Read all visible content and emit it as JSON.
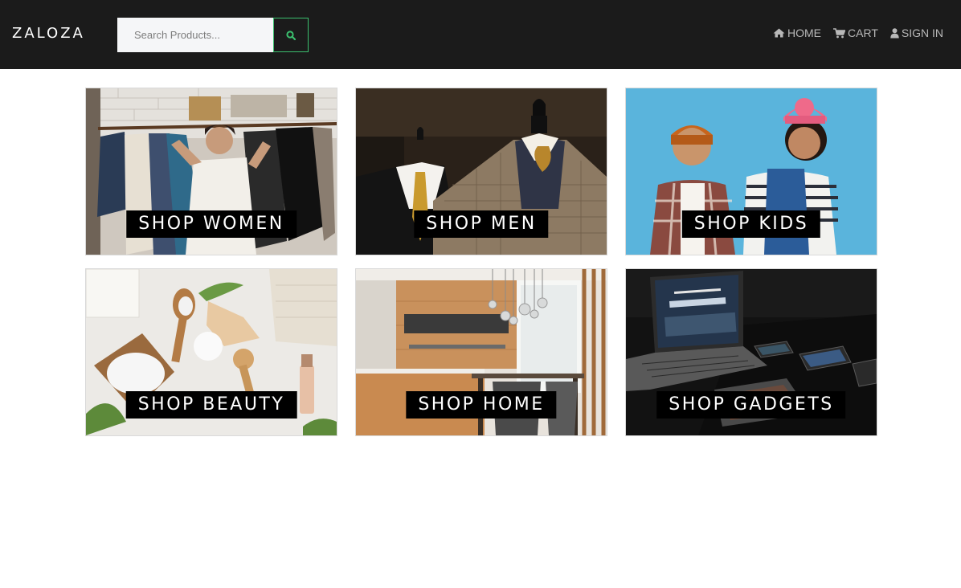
{
  "brand": "ZALOZA",
  "search": {
    "placeholder": "Search Products..."
  },
  "nav": {
    "home": "HOME",
    "cart": "CART",
    "signin": "SIGN IN"
  },
  "tiles": [
    {
      "label": "SHOP WOMEN"
    },
    {
      "label": "SHOP MEN"
    },
    {
      "label": "SHOP KIDS"
    },
    {
      "label": "SHOP BEAUTY"
    },
    {
      "label": "SHOP HOME"
    },
    {
      "label": "SHOP GADGETS"
    }
  ],
  "colors": {
    "navbar": "#1b1b1b",
    "accent": "#3bbf6e",
    "nav_text": "#b8b8b8"
  },
  "icons": {
    "search": "search-icon",
    "home": "home-icon",
    "cart": "cart-icon",
    "user": "user-icon"
  }
}
